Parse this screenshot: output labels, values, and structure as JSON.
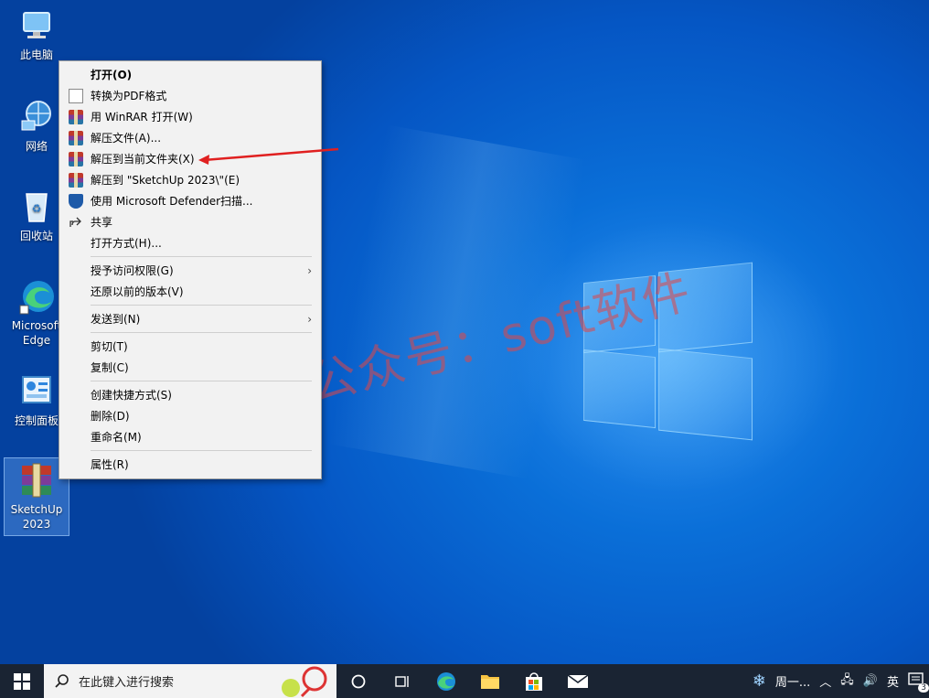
{
  "desktop": {
    "icons": [
      {
        "label": "此电脑"
      },
      {
        "label": "网络"
      },
      {
        "label": "回收站"
      },
      {
        "label": "Microsoft Edge"
      },
      {
        "label": "控制面板"
      },
      {
        "label": "SketchUp 2023"
      }
    ]
  },
  "context_menu": {
    "items": [
      {
        "label": "打开(O)",
        "icon": "none"
      },
      {
        "label": "转换为PDF格式",
        "icon": "document-icon"
      },
      {
        "label": "用 WinRAR 打开(W)",
        "icon": "winrar-icon"
      },
      {
        "label": "解压文件(A)...",
        "icon": "winrar-icon"
      },
      {
        "label": "解压到当前文件夹(X)",
        "icon": "winrar-icon"
      },
      {
        "label": "解压到 \"SketchUp 2023\\\"(E)",
        "icon": "winrar-icon"
      },
      {
        "label": "使用 Microsoft Defender扫描...",
        "icon": "defender-icon"
      },
      {
        "label": "共享",
        "icon": "share-icon"
      },
      {
        "label": "打开方式(H)...",
        "icon": "none"
      },
      {
        "label": "授予访问权限(G)",
        "icon": "none",
        "submenu": true
      },
      {
        "label": "还原以前的版本(V)",
        "icon": "none"
      },
      {
        "label": "发送到(N)",
        "icon": "none",
        "submenu": true
      },
      {
        "label": "剪切(T)",
        "icon": "none"
      },
      {
        "label": "复制(C)",
        "icon": "none"
      },
      {
        "label": "创建快捷方式(S)",
        "icon": "none"
      },
      {
        "label": "删除(D)",
        "icon": "none"
      },
      {
        "label": "重命名(M)",
        "icon": "none"
      },
      {
        "label": "属性(R)",
        "icon": "none"
      }
    ]
  },
  "watermark": "微信公众号：soft软件",
  "taskbar": {
    "search_placeholder": "在此键入进行搜索",
    "tray_weather": "周一...",
    "tray_ime": "英",
    "notification_count": "3"
  },
  "colors": {
    "desktop_blue": "#0a6fd8",
    "annotation_red": "#e02020",
    "taskbar_bg": "#1a2433"
  }
}
